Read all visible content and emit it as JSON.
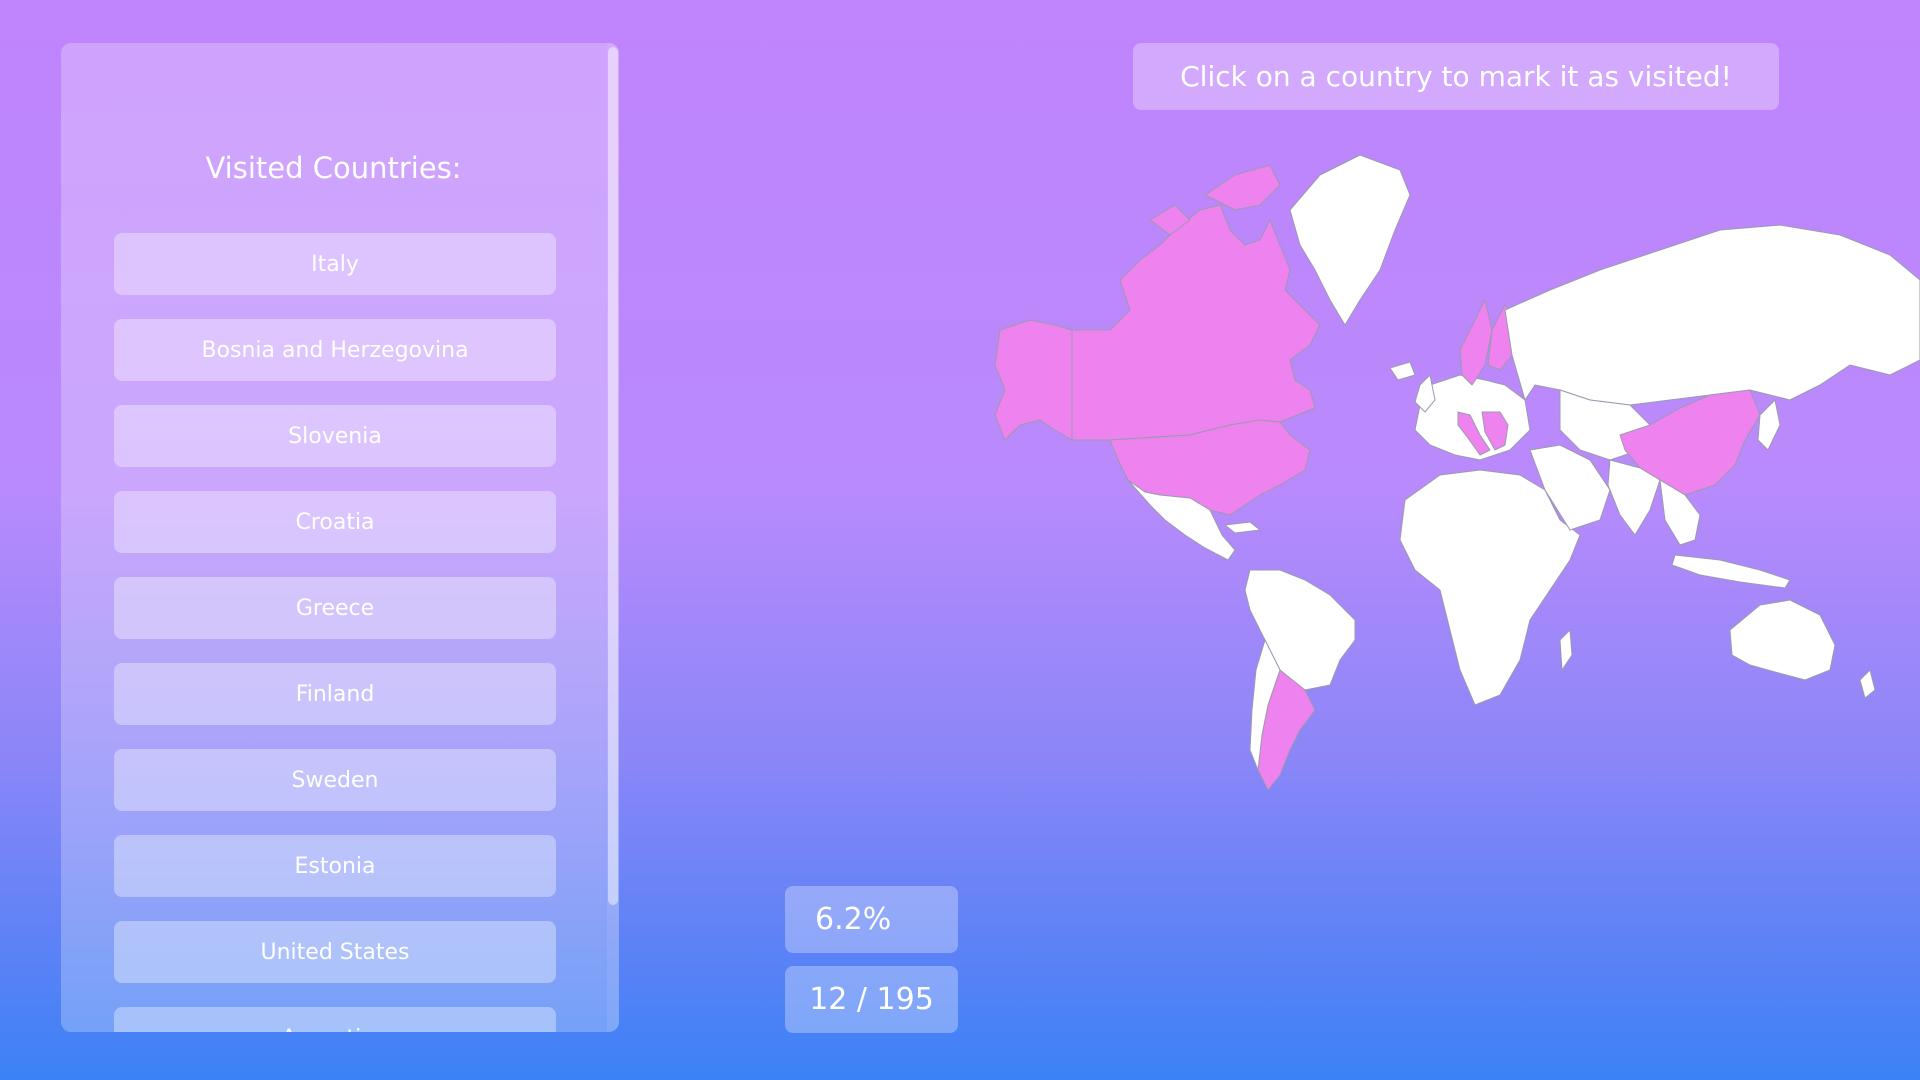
{
  "sidebar": {
    "title": "Visited Countries:",
    "items": [
      {
        "label": "Italy"
      },
      {
        "label": "Bosnia and Herzegovina"
      },
      {
        "label": "Slovenia"
      },
      {
        "label": "Croatia"
      },
      {
        "label": "Greece"
      },
      {
        "label": "Finland"
      },
      {
        "label": "Sweden"
      },
      {
        "label": "Estonia"
      },
      {
        "label": "United States"
      },
      {
        "label": "Argentina"
      }
    ]
  },
  "instruction": "Click on a country to mark it as visited!",
  "stats": {
    "percent": "6.2%",
    "count": "12 / 195"
  },
  "colors": {
    "visited": "#ee82ee",
    "unvisited": "#ffffff",
    "border": "#9a9ab0",
    "bg_top": "#c084fc",
    "bg_bottom": "#3b82f6"
  }
}
